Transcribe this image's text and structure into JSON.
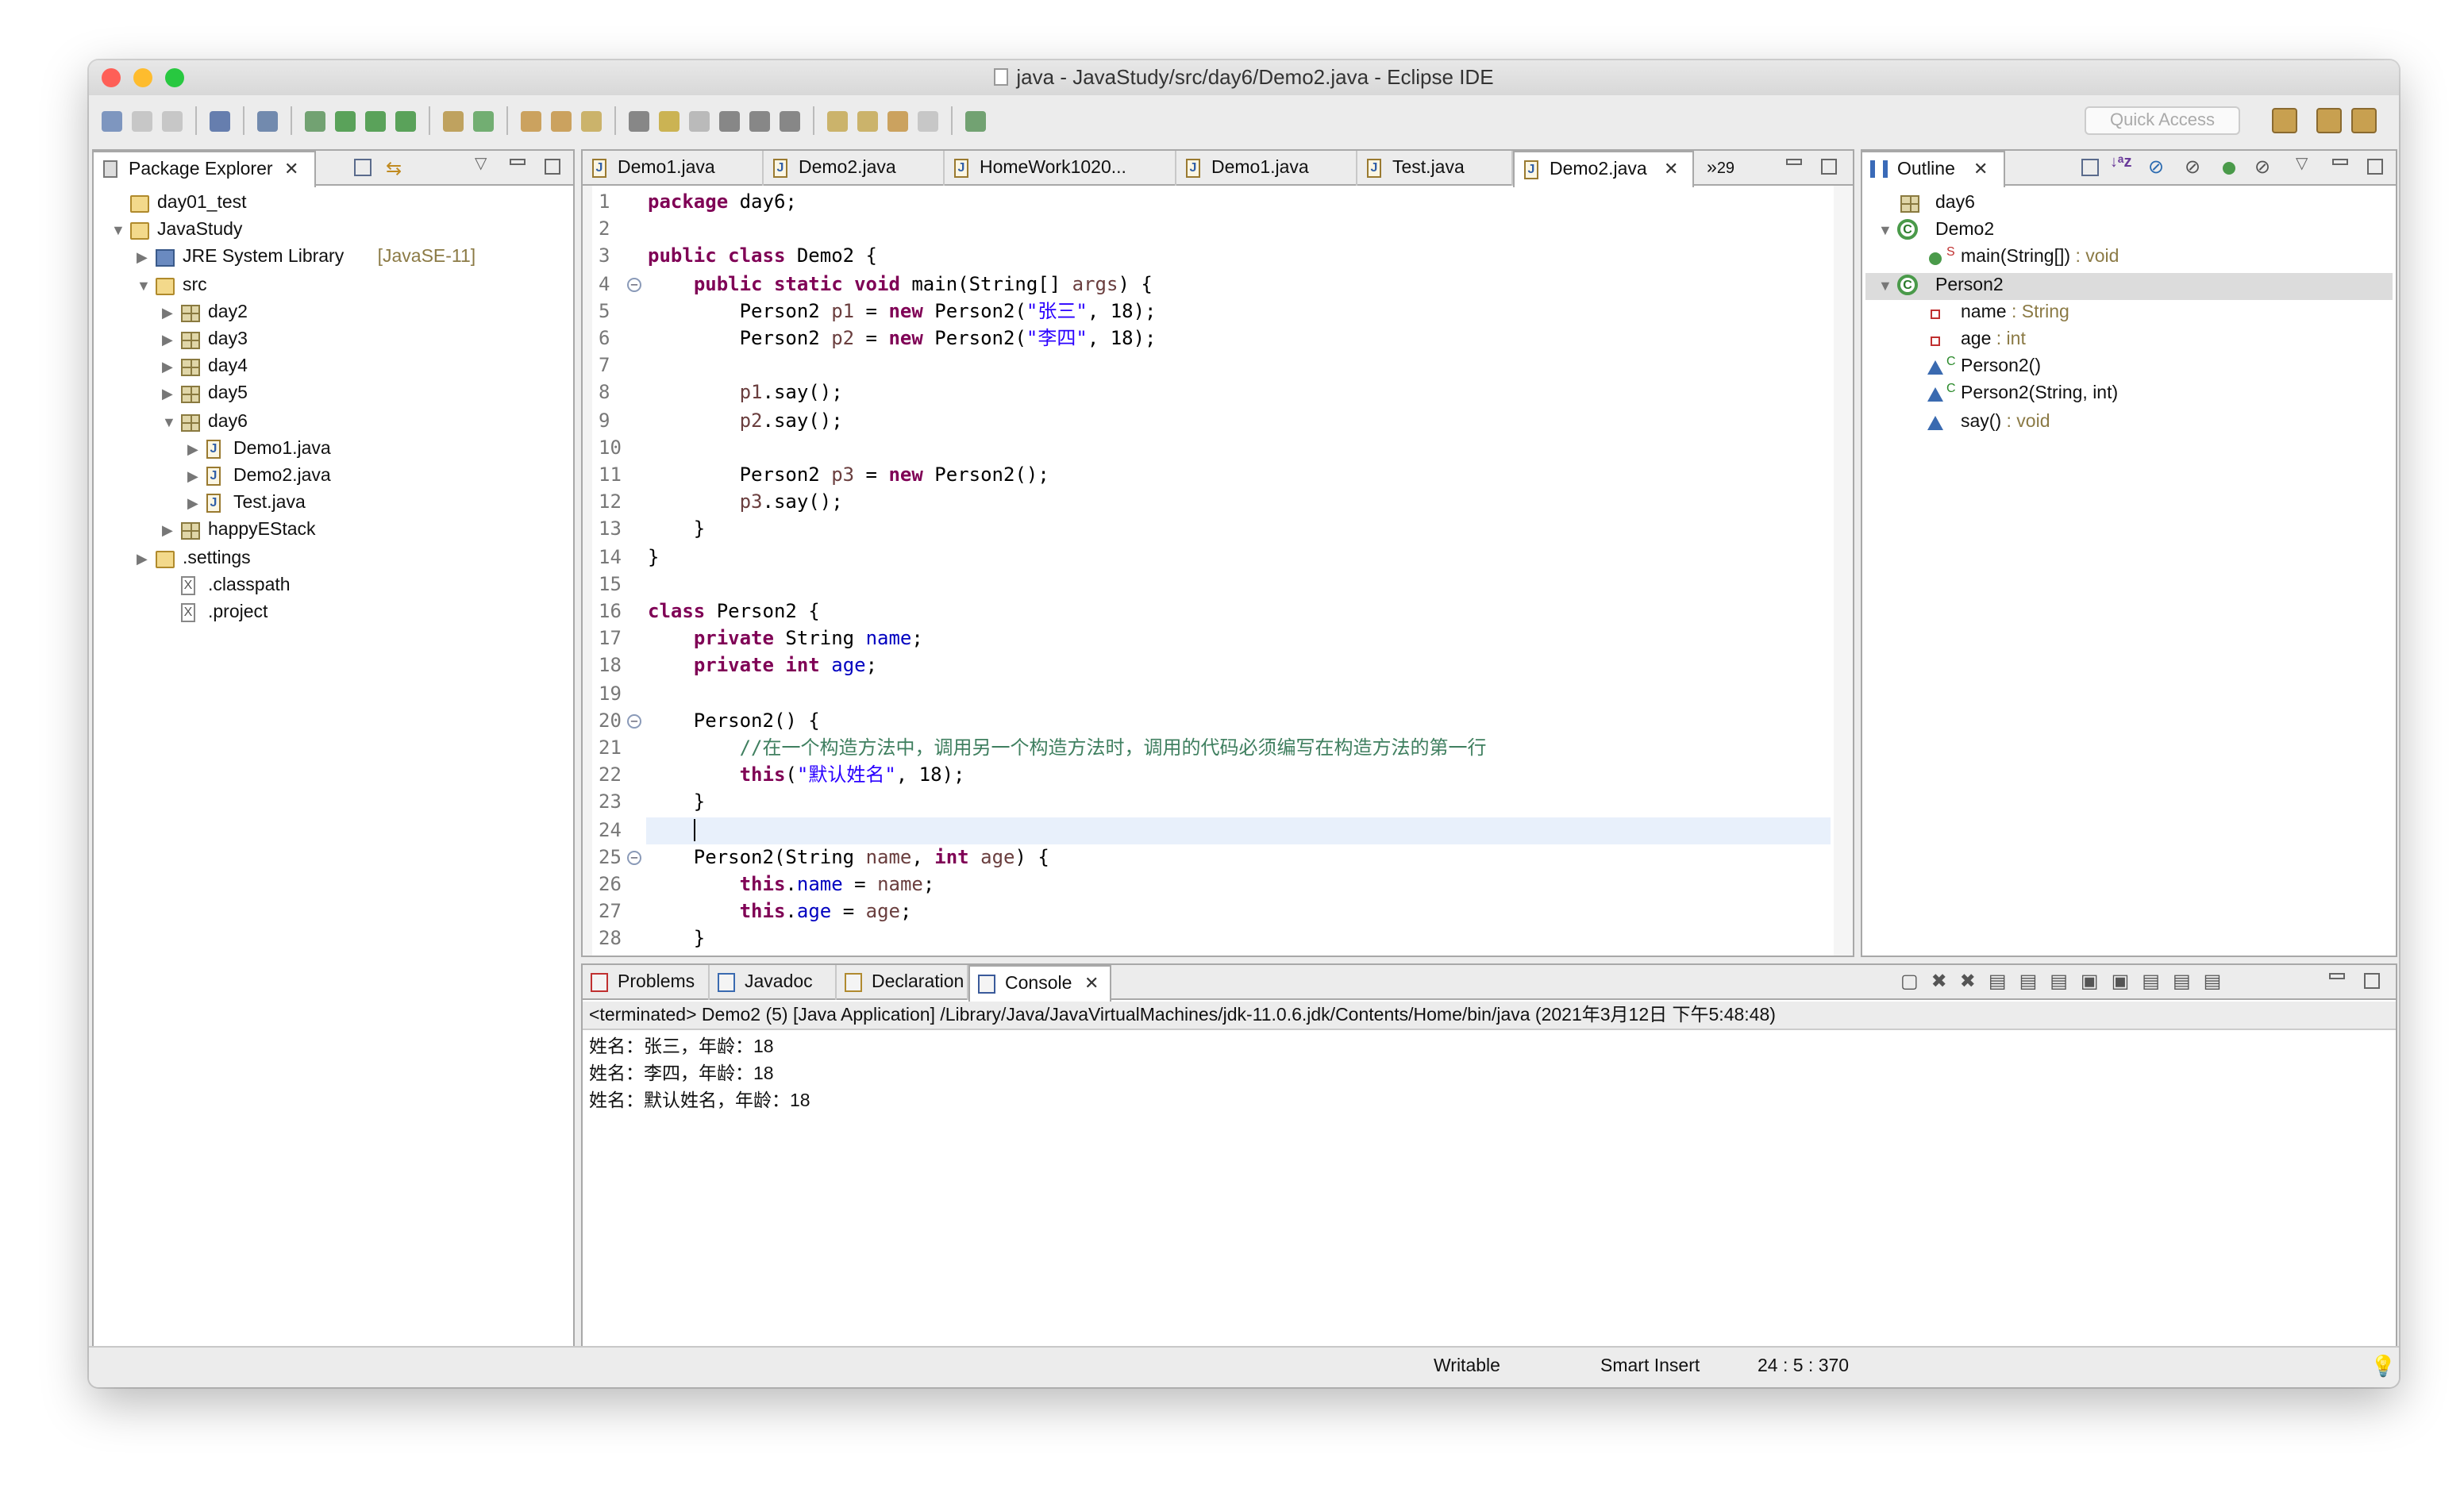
{
  "window": {
    "title": "java - JavaStudy/src/day6/Demo2.java - Eclipse IDE"
  },
  "toolbar": {
    "quick_access_placeholder": "Quick Access"
  },
  "package_explorer": {
    "title": "Package Explorer",
    "items": [
      {
        "label": "day01_test",
        "level": 0,
        "arrow": "",
        "icon": "project"
      },
      {
        "label": "JavaStudy",
        "level": 0,
        "arrow": "open",
        "icon": "project"
      },
      {
        "label": "JRE System Library",
        "suffix": "[JavaSE-11]",
        "level": 1,
        "arrow": "closed",
        "icon": "library"
      },
      {
        "label": "src",
        "level": 1,
        "arrow": "open",
        "icon": "source-folder"
      },
      {
        "label": "day2",
        "level": 2,
        "arrow": "closed",
        "icon": "package"
      },
      {
        "label": "day3",
        "level": 2,
        "arrow": "closed",
        "icon": "package"
      },
      {
        "label": "day4",
        "level": 2,
        "arrow": "closed",
        "icon": "package"
      },
      {
        "label": "day5",
        "level": 2,
        "arrow": "closed",
        "icon": "package"
      },
      {
        "label": "day6",
        "level": 2,
        "arrow": "open",
        "icon": "package"
      },
      {
        "label": "Demo1.java",
        "level": 3,
        "arrow": "closed",
        "icon": "java-file"
      },
      {
        "label": "Demo2.java",
        "level": 3,
        "arrow": "closed",
        "icon": "java-file"
      },
      {
        "label": "Test.java",
        "level": 3,
        "arrow": "closed",
        "icon": "java-file"
      },
      {
        "label": "happyEStack",
        "level": 2,
        "arrow": "closed",
        "icon": "package"
      },
      {
        "label": ".settings",
        "level": 1,
        "arrow": "closed",
        "icon": "folder"
      },
      {
        "label": ".classpath",
        "level": 2,
        "arrow": "",
        "icon": "xml-file"
      },
      {
        "label": ".project",
        "level": 2,
        "arrow": "",
        "icon": "xml-file"
      }
    ]
  },
  "editor": {
    "tabs": [
      {
        "label": "Demo1.java"
      },
      {
        "label": "Demo2.java"
      },
      {
        "label": "HomeWork1020..."
      },
      {
        "label": "Demo1.java"
      },
      {
        "label": "Test.java"
      },
      {
        "label": "Demo2.java",
        "active": true
      }
    ],
    "overflow_count": "29",
    "current_line": 24,
    "lines": [
      [
        [
          "package",
          "k"
        ],
        [
          " day6;",
          "p"
        ]
      ],
      [],
      [
        [
          "public class",
          "k"
        ],
        [
          " Demo2 {",
          "p"
        ]
      ],
      [
        [
          "    "
        ],
        [
          "public static void",
          "k"
        ],
        [
          " main(String[] ",
          "p"
        ],
        [
          "args",
          "v"
        ],
        [
          ") {",
          "p"
        ]
      ],
      [
        [
          "        Person2 "
        ],
        [
          "p1",
          "v"
        ],
        [
          " = ",
          "p"
        ],
        [
          "new",
          "k"
        ],
        [
          " Person2(",
          "p"
        ],
        [
          "\"张三\"",
          "s"
        ],
        [
          ", 18);",
          "p"
        ]
      ],
      [
        [
          "        Person2 "
        ],
        [
          "p2",
          "v"
        ],
        [
          " = ",
          "p"
        ],
        [
          "new",
          "k"
        ],
        [
          " Person2(",
          "p"
        ],
        [
          "\"李四\"",
          "s"
        ],
        [
          ", 18);",
          "p"
        ]
      ],
      [],
      [
        [
          "        "
        ],
        [
          "p1",
          "v"
        ],
        [
          ".say();",
          "p"
        ]
      ],
      [
        [
          "        "
        ],
        [
          "p2",
          "v"
        ],
        [
          ".say();",
          "p"
        ]
      ],
      [],
      [
        [
          "        Person2 "
        ],
        [
          "p3",
          "v"
        ],
        [
          " = ",
          "p"
        ],
        [
          "new",
          "k"
        ],
        [
          " Person2();",
          "p"
        ]
      ],
      [
        [
          "        "
        ],
        [
          "p3",
          "v"
        ],
        [
          ".say();",
          "p"
        ]
      ],
      [
        [
          "    }"
        ]
      ],
      [
        [
          "}"
        ]
      ],
      [],
      [
        [
          "class",
          "k"
        ],
        [
          " Person2 {",
          "p"
        ]
      ],
      [
        [
          "    "
        ],
        [
          "private",
          "k"
        ],
        [
          " String ",
          "p"
        ],
        [
          "name",
          "f"
        ],
        [
          ";",
          "p"
        ]
      ],
      [
        [
          "    "
        ],
        [
          "private int",
          "k"
        ],
        [
          " ",
          "p"
        ],
        [
          "age",
          "f"
        ],
        [
          ";",
          "p"
        ]
      ],
      [],
      [
        [
          "    Person2() {"
        ]
      ],
      [
        [
          "        "
        ],
        [
          "//在一个构造方法中，调用另一个构造方法时，调用的代码必须编写在构造方法的第一行",
          "c"
        ]
      ],
      [
        [
          "        "
        ],
        [
          "this",
          "k"
        ],
        [
          "(",
          "p"
        ],
        [
          "\"默认姓名\"",
          "s"
        ],
        [
          ", 18);",
          "p"
        ]
      ],
      [
        [
          "    }"
        ]
      ],
      [
        [
          "    "
        ]
      ],
      [
        [
          "    Person2(String "
        ],
        [
          "name",
          "v"
        ],
        [
          ", ",
          "p"
        ],
        [
          "int",
          "k"
        ],
        [
          " ",
          "p"
        ],
        [
          "age",
          "v"
        ],
        [
          ") {",
          "p"
        ]
      ],
      [
        [
          "        "
        ],
        [
          "this",
          "k"
        ],
        [
          ".",
          "p"
        ],
        [
          "name",
          "f"
        ],
        [
          " = ",
          "p"
        ],
        [
          "name",
          "v"
        ],
        [
          ";",
          "p"
        ]
      ],
      [
        [
          "        "
        ],
        [
          "this",
          "k"
        ],
        [
          ".",
          "p"
        ],
        [
          "age",
          "f"
        ],
        [
          " = ",
          "p"
        ],
        [
          "age",
          "v"
        ],
        [
          ";",
          "p"
        ]
      ],
      [
        [
          "    }"
        ]
      ]
    ],
    "fold_lines": [
      4,
      20,
      25
    ]
  },
  "outline": {
    "title": "Outline",
    "items": [
      {
        "label": "day6",
        "type": "",
        "level": 0,
        "icon": "package"
      },
      {
        "label": "Demo2",
        "type": "",
        "level": 0,
        "arrow": "open",
        "icon": "class"
      },
      {
        "label": "main(String[])",
        "type": " : void",
        "level": 1,
        "icon": "public-method",
        "mod": "S"
      },
      {
        "label": "Person2",
        "type": "",
        "level": 0,
        "arrow": "open",
        "icon": "class",
        "selected": true
      },
      {
        "label": "name",
        "type": " : String",
        "level": 1,
        "icon": "private-field"
      },
      {
        "label": "age",
        "type": " : int",
        "level": 1,
        "icon": "private-field"
      },
      {
        "label": "Person2()",
        "type": "",
        "level": 1,
        "icon": "default-method",
        "mod": "C"
      },
      {
        "label": "Person2(String, int)",
        "type": "",
        "level": 1,
        "icon": "default-method",
        "mod": "C"
      },
      {
        "label": "say()",
        "type": " : void",
        "level": 1,
        "icon": "default-method"
      }
    ]
  },
  "bottom": {
    "tabs": [
      {
        "label": "Problems"
      },
      {
        "label": "Javadoc"
      },
      {
        "label": "Declaration"
      },
      {
        "label": "Console",
        "active": true
      }
    ],
    "console_header": "<terminated> Demo2 (5) [Java Application] /Library/Java/JavaVirtualMachines/jdk-11.0.6.jdk/Contents/Home/bin/java (2021年3月12日 下午5:48:48)",
    "output": [
      "姓名：张三，年龄：18",
      "姓名：李四，年龄：18",
      "姓名：默认姓名，年龄：18"
    ]
  },
  "status": {
    "writable": "Writable",
    "insert_mode": "Smart Insert",
    "position": "24 : 5 : 370"
  }
}
